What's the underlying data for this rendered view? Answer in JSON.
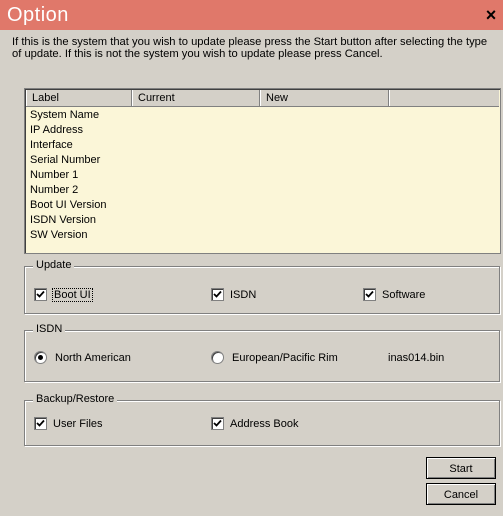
{
  "window": {
    "title": "Option",
    "close_glyph": "×"
  },
  "intro": {
    "line1": "If this is the system that you wish to update please press the Start button after selecting the type",
    "line2": "of update. If this is not the system you wish to update please press Cancel."
  },
  "list": {
    "columns": [
      "Label",
      "Current",
      "New"
    ],
    "rows": [
      "System Name",
      "IP Address",
      "Interface",
      "Serial Number",
      "Number 1",
      "Number 2",
      "Boot UI Version",
      "ISDN Version",
      "SW Version"
    ]
  },
  "update": {
    "legend": "Update",
    "boot_ui": {
      "label": "Boot UI",
      "checked": true
    },
    "isdn": {
      "label": "ISDN",
      "checked": true
    },
    "software": {
      "label": "Software",
      "checked": true
    }
  },
  "isdn_group": {
    "legend": "ISDN",
    "north_american": {
      "label": "North American",
      "selected": true
    },
    "european": {
      "label": "European/Pacific Rim",
      "selected": false
    },
    "file": "inas014.bin"
  },
  "backup": {
    "legend": "Backup/Restore",
    "user_files": {
      "label": "User Files",
      "checked": true
    },
    "address_book": {
      "label": "Address Book",
      "checked": true
    }
  },
  "buttons": {
    "start": "Start",
    "cancel": "Cancel"
  },
  "colors": {
    "titlebar": "#e0786a",
    "dialog": "#d4d0c8",
    "list_bg": "#fbf6d8"
  }
}
